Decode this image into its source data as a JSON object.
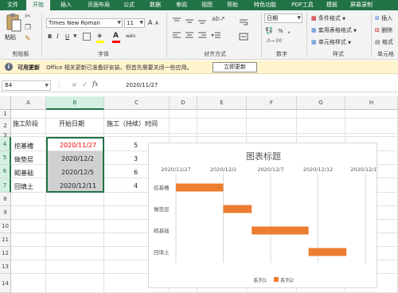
{
  "ribbon_tabs": [
    {
      "label": "文件",
      "active": false
    },
    {
      "label": "开始",
      "active": true
    },
    {
      "label": "插入",
      "active": false
    },
    {
      "label": "页面布局",
      "active": false
    },
    {
      "label": "公式",
      "active": false
    },
    {
      "label": "数据",
      "active": false
    },
    {
      "label": "审阅",
      "active": false
    },
    {
      "label": "视图",
      "active": false
    },
    {
      "label": "帮助",
      "active": false
    },
    {
      "label": "特色功能",
      "active": false
    },
    {
      "label": "PDF工具",
      "active": false
    },
    {
      "label": "模板",
      "active": false
    },
    {
      "label": "屏幕录制",
      "active": false
    }
  ],
  "ribbon": {
    "clipboard": {
      "paste": "粘贴",
      "group": "剪贴板"
    },
    "font": {
      "name": "Times New Roman",
      "size": "11",
      "grow": "A",
      "shrink": "A",
      "bold": "B",
      "italic": "I",
      "underline": "U",
      "font_color_letter": "A",
      "phonetic": "wén",
      "group": "字体",
      "font_color": "#ff0000",
      "fill_color": "#ffff00"
    },
    "alignment": {
      "group": "对齐方式"
    },
    "number": {
      "format": "日期",
      "percent": "%",
      "comma": ",",
      "group": "数字"
    },
    "styles": {
      "conditional": "条件格式",
      "table": "套用表格格式",
      "cell_styles": "单元格样式",
      "group": "样式"
    },
    "cells": {
      "insert": "插入",
      "delete": "删除",
      "format": "格式",
      "group": "单元格"
    }
  },
  "notification": {
    "title": "可用更新",
    "message": "Office 相关更新已准备好安装，但首先需要关闭一些应用。",
    "button": "立即更新"
  },
  "formula_bar": {
    "name_box": "B4",
    "cancel": "×",
    "enter": "✓",
    "fx": "fx",
    "content": "2020/11/27"
  },
  "columns": [
    "A",
    "B",
    "C",
    "D",
    "E",
    "F",
    "G",
    "H"
  ],
  "rows": [
    "1",
    "2",
    "3",
    "4",
    "5",
    "6",
    "7",
    "8",
    "9",
    "10",
    "11",
    "12",
    "13",
    "14"
  ],
  "cells": {
    "A2": "施工阶段",
    "B2": "开始日期",
    "C2": "施工（持续）时间",
    "A4": "挖基槽",
    "B4": "2020/11/27",
    "C4": "5",
    "A5": "做垫层",
    "B5": "2020/12/2",
    "C5": "3",
    "A6": "砌基础",
    "B6": "2020/12/5",
    "C6": "6",
    "A7": "回填土",
    "B7": "2020/12/11",
    "C7": "4"
  },
  "colors": {
    "accent": "#217346",
    "series2": "#ed7d31",
    "error_text": "#ff0000",
    "notify_bg": "#fff4ce"
  },
  "chart_data": {
    "type": "bar",
    "orientation": "horizontal",
    "stacked": true,
    "title": "图表标题",
    "categories": [
      "挖基槽",
      "做垫层",
      "砌基础",
      "回填土"
    ],
    "series": [
      {
        "name": "系列1",
        "values": [
          "2020/11/27",
          "2020/12/2",
          "2020/12/5",
          "2020/12/11"
        ],
        "visible": false
      },
      {
        "name": "系列2",
        "values": [
          5,
          3,
          6,
          4
        ],
        "color": "#ed7d31"
      }
    ],
    "x_tick_labels": [
      "2020/11/27",
      "2020/12/2",
      "2020/12/7",
      "2020/12/12",
      "2020/12/17"
    ],
    "xlim": [
      "2020/11/27",
      "2020/12/17"
    ],
    "x_axis_position": "top",
    "y_reversed": true,
    "grid": true,
    "legend": "bottom"
  }
}
